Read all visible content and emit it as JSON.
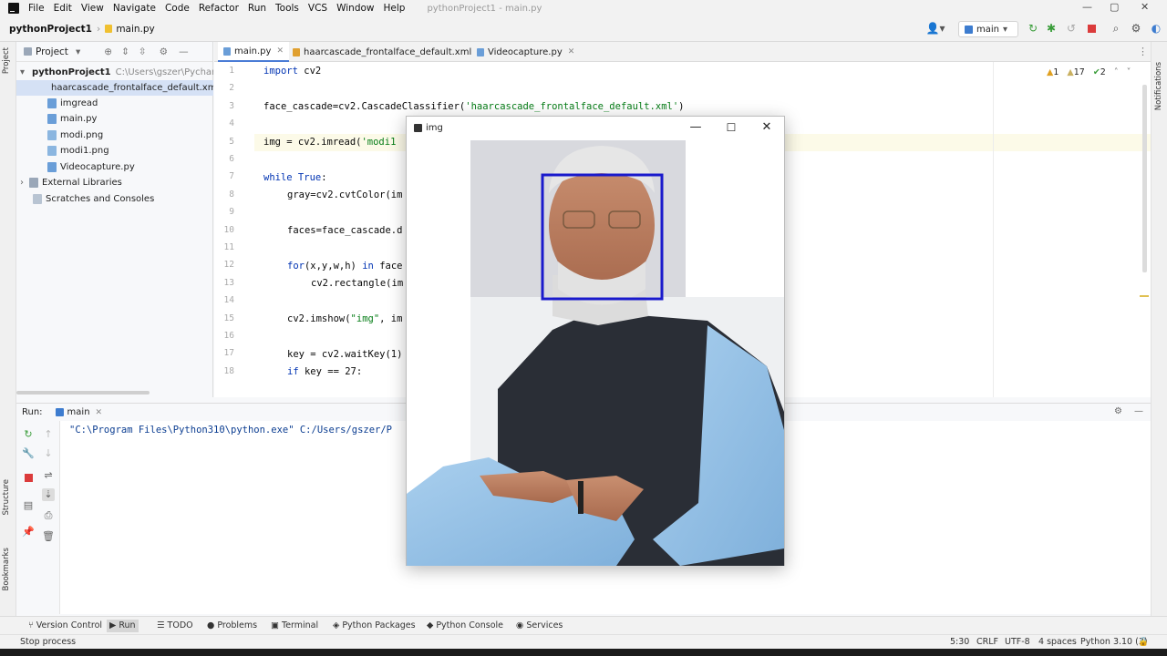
{
  "menubar": {
    "items": [
      "File",
      "Edit",
      "View",
      "Navigate",
      "Code",
      "Refactor",
      "Run",
      "Tools",
      "VCS",
      "Window",
      "Help"
    ],
    "window_title": "pythonProject1 - main.py"
  },
  "navbar": {
    "project": "pythonProject1",
    "file": "main.py",
    "branch": "main"
  },
  "project_panel": {
    "header": "Project",
    "root_name": "pythonProject1",
    "root_path": "C:\\Users\\gszer\\Pycharm",
    "items": [
      {
        "label": "haarcascade_frontalface_default.xml",
        "selected": true
      },
      {
        "label": "imgread"
      },
      {
        "label": "main.py"
      },
      {
        "label": "modi.png"
      },
      {
        "label": "modi1.png"
      },
      {
        "label": "Videocapture.py"
      }
    ],
    "external_libraries": "External Libraries",
    "scratches": "Scratches and Consoles"
  },
  "editor": {
    "tabs": [
      {
        "label": "main.py",
        "active": true
      },
      {
        "label": "haarcascade_frontalface_default.xml"
      },
      {
        "label": "Videocapture.py"
      }
    ],
    "line_numbers": [
      "1",
      "2",
      "3",
      "4",
      "5",
      "6",
      "7",
      "8",
      "9",
      "10",
      "11",
      "12",
      "13",
      "14",
      "15",
      "16",
      "17",
      "18"
    ],
    "code": {
      "l1": "cv2",
      "l1_kw": "import",
      "l3_a": "face_cascade=cv2.CascadeClassifier(",
      "l3_str": "'haarcascade_frontalface_default.xml'",
      "l3_b": ")",
      "l5_a": "img = cv2.imread(",
      "l5_str": "'modi1",
      "l7_kw": "while True",
      "l7_b": ":",
      "l8": "gray=cv2.cvtColor(im",
      "l10": "faces=face_cascade.d",
      "l12_kw": "for",
      "l12_a": "(x,y,w,h)",
      "l12_kw2": "in",
      "l12_b": "face",
      "l13": "cv2.rectangle(im",
      "l15_a": "cv2.imshow(",
      "l15_str": "\"img\"",
      "l15_b": ", im",
      "l17": "key = cv2.waitKey(1)",
      "l18_kw": "if",
      "l18_b": "key == 27:"
    },
    "inspections": {
      "warnings": "1",
      "weak_warnings": "17",
      "typos": "2"
    }
  },
  "run_panel": {
    "label": "Run:",
    "config": "main",
    "output": "\"C:\\Program Files\\Python310\\python.exe\" C:/Users/gszer/P"
  },
  "image_window": {
    "title": "img",
    "face_box_color": "#1a1acc"
  },
  "bottom_tabs": [
    "Version Control",
    "Run",
    "TODO",
    "Problems",
    "Terminal",
    "Python Packages",
    "Python Console",
    "Services"
  ],
  "status": {
    "left": "Stop process",
    "position": "5:30",
    "line_sep": "CRLF",
    "encoding": "UTF-8",
    "indent": "4 spaces",
    "interpreter": "Python 3.10 (3)"
  },
  "side_labels": {
    "project": "Project",
    "structure": "Structure",
    "bookmarks": "Bookmarks",
    "notifications": "Notifications"
  }
}
